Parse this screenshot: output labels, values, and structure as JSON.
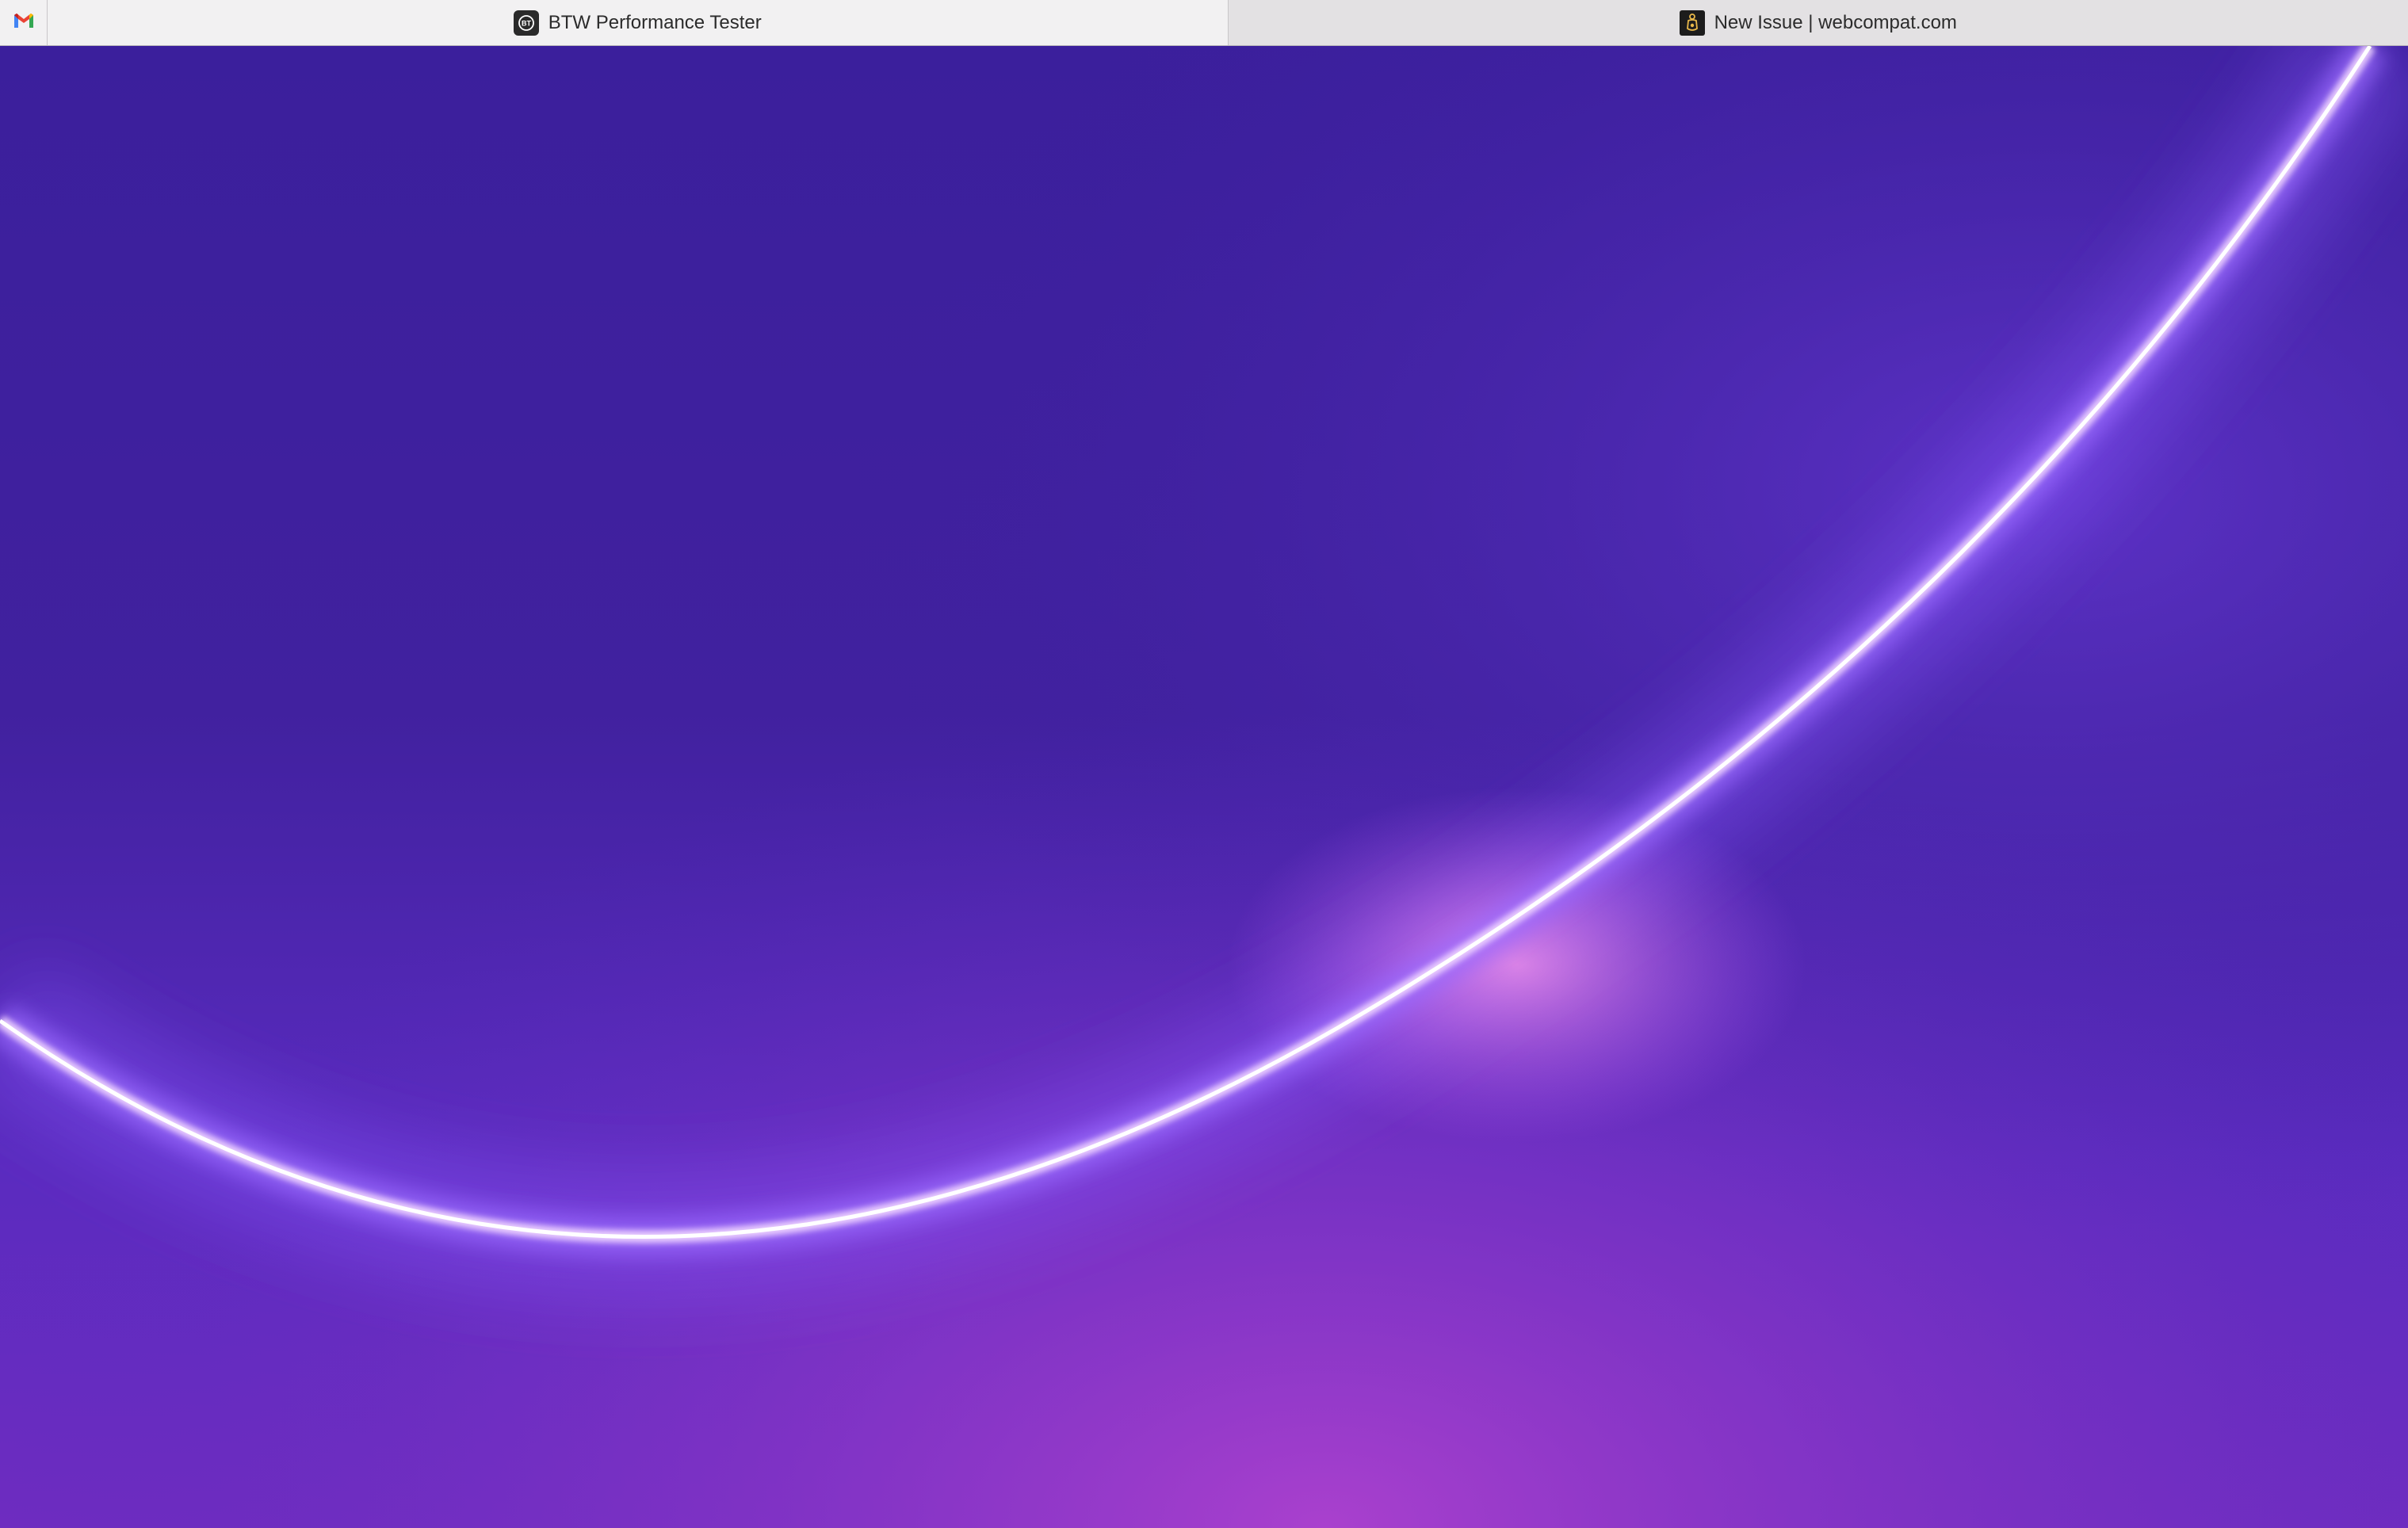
{
  "browser": {
    "pinned_tab": {
      "icon": "gmail-icon"
    },
    "tabs": [
      {
        "title": "BTW Performance Tester",
        "icon": "btw-favicon-icon",
        "active": true
      },
      {
        "title": "New Issue | webcompat.com",
        "icon": "webcompat-favicon-icon",
        "active": false
      }
    ]
  },
  "colors": {
    "background_dark": "#3a1f9a",
    "background_mid": "#5a2bc4",
    "background_bottom": "#9a3ec8",
    "arc_glow": "#8b5cff",
    "arc_core": "#ffffff"
  }
}
